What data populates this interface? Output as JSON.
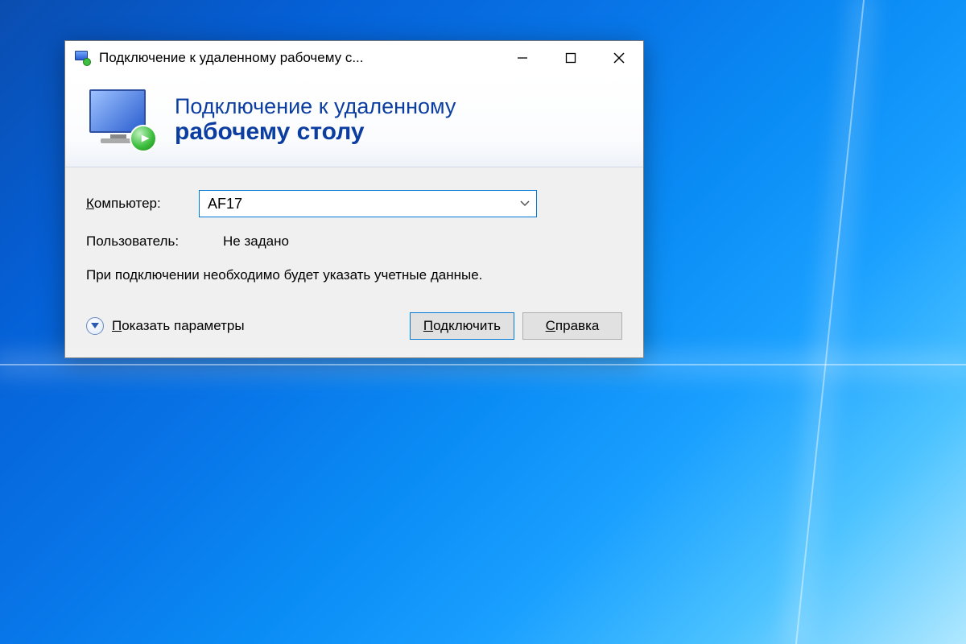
{
  "titlebar": {
    "title": "Подключение к удаленному рабочему с..."
  },
  "banner": {
    "line1": "Подключение к удаленному",
    "line2": "рабочему столу"
  },
  "form": {
    "computer_label_pre": "К",
    "computer_label_rest": "омпьютер:",
    "computer_value": "AF17",
    "user_label": "Пользователь:",
    "user_value": "Не задано",
    "hint": "При подключении необходимо будет указать учетные данные."
  },
  "footer": {
    "expand_pre": "П",
    "expand_rest": "оказать параметры",
    "connect_pre": "П",
    "connect_rest": "одключить",
    "help_pre": "С",
    "help_rest": "правка"
  }
}
